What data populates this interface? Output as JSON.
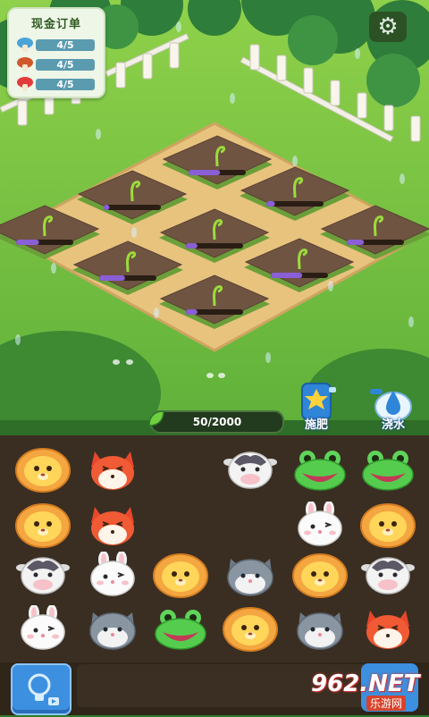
{
  "orders": {
    "title": "现金订单",
    "items": [
      {
        "progress": "4/5",
        "color": "#4aa4d8"
      },
      {
        "progress": "4/5",
        "color": "#d0572a"
      },
      {
        "progress": "4/5",
        "color": "#e23a3a"
      }
    ]
  },
  "settings": {
    "icon": "gear-icon",
    "glyph": "⚙"
  },
  "farm": {
    "plots": [
      {
        "growth": 0.55
      },
      {
        "growth": 0.1
      },
      {
        "growth": 0.15
      },
      {
        "growth": 0.4
      },
      {
        "growth": 0.2
      },
      {
        "growth": 0.3
      },
      {
        "growth": 0.45
      },
      {
        "growth": 0.55
      },
      {
        "growth": 0.2
      }
    ]
  },
  "progress": {
    "label": "50/2000",
    "value": 50,
    "max": 2000
  },
  "tools": {
    "fertilize": {
      "label": "施肥"
    },
    "water": {
      "label": "浇水"
    }
  },
  "board": {
    "rows": [
      [
        "lion",
        "fox",
        "",
        "cow",
        "frog",
        "frog"
      ],
      [
        "lion",
        "fox",
        "",
        "",
        "rabbit",
        "lion"
      ],
      [
        "cow",
        "rabbit",
        "lion",
        "cat",
        "lion",
        "cow"
      ],
      [
        "rabbit",
        "cat",
        "frog",
        "lion",
        "cat",
        "fox"
      ]
    ]
  },
  "watermark": {
    "brand": "962.NET",
    "sub": "乐游网"
  }
}
